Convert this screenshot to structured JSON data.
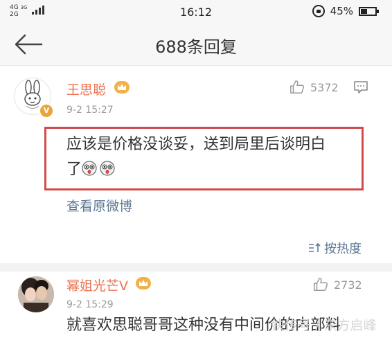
{
  "status_bar": {
    "network_top": "4G",
    "network_bottom": "2G",
    "network_mid": "3G",
    "time": "16:12",
    "battery": "45%",
    "battery_level": 0.45
  },
  "nav": {
    "title": "688条回复"
  },
  "main_comment": {
    "username": "王思聪",
    "verified_badge": "V",
    "time": "9-2 15:27",
    "likes": "5372",
    "text_line1": "应该是价格没谈妥，送到局里后谈明白",
    "text_line2": "了",
    "emoji_count": 2,
    "view_original": "查看原微博",
    "highlight_color": "#d24a4a"
  },
  "sort": {
    "label": "按热度"
  },
  "reply_comment": {
    "username": "幂姐光芒V",
    "time": "9-2 15:29",
    "likes": "2732",
    "text": "就喜欢思聪哥哥这种没有中间价的内部料"
  },
  "watermark": {
    "text": "快传号 / 东方启峰"
  },
  "colors": {
    "username": "#eb7350",
    "link": "#5d7895",
    "badge": "#e9a43b"
  }
}
